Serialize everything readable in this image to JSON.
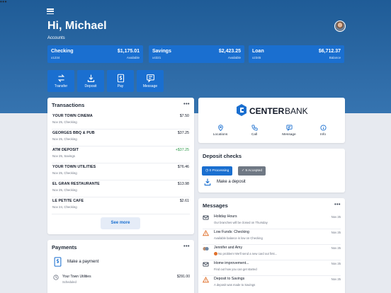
{
  "header": {
    "greeting": "Hi, Michael",
    "accounts_label": "Accounts",
    "more": "•••"
  },
  "accounts": [
    {
      "name": "Checking",
      "number": "x1234",
      "amount": "$1,175.01",
      "kind": "Available"
    },
    {
      "name": "Savings",
      "number": "x4321",
      "amount": "$2,423.25",
      "kind": "Available"
    },
    {
      "name": "Loan",
      "number": "x2345",
      "amount": "$6,712.37",
      "kind": "Balance"
    }
  ],
  "actions": [
    {
      "label": "Transfer",
      "icon": "transfer-icon"
    },
    {
      "label": "Deposit",
      "icon": "deposit-icon"
    },
    {
      "label": "Pay",
      "icon": "pay-icon"
    },
    {
      "label": "Message",
      "icon": "message-icon"
    }
  ],
  "transactions": {
    "title": "Transactions",
    "more": "•••",
    "items": [
      {
        "name": "YOUR TOWN CINEMA",
        "sub": "Nov 25, Checking",
        "amount": "$7.50",
        "positive": false
      },
      {
        "name": "GEORGES BBQ & PUB",
        "sub": "Nov 25, Checking",
        "amount": "$37.25",
        "positive": false
      },
      {
        "name": "ATM DEPOSIT",
        "sub": "Nov 25, Savings",
        "amount": "+$37.25",
        "positive": true
      },
      {
        "name": "YOUR TOWN UTILITIES",
        "sub": "Nov 25, Checking",
        "amount": "$76.46",
        "positive": false
      },
      {
        "name": "EL GRAN RESTAURANTE",
        "sub": "Nov 25, Checking",
        "amount": "$13.98",
        "positive": false
      },
      {
        "name": "LE PETITE CAFE",
        "sub": "Nov 24, Checking",
        "amount": "$2.61",
        "positive": false
      }
    ],
    "see_more": "See more"
  },
  "payments": {
    "title": "Payments",
    "more": "•••",
    "make_payment": "Make a payment",
    "items": [
      {
        "name": "Your Town Utilities",
        "status": "Scheduled",
        "amount": "$291.00"
      }
    ]
  },
  "bank": {
    "name_bold": "CENTER",
    "name_light": "BANK",
    "quick": [
      {
        "label": "Locations",
        "icon": "location-icon"
      },
      {
        "label": "Call",
        "icon": "phone-icon"
      },
      {
        "label": "Message",
        "icon": "message-icon"
      },
      {
        "label": "Info",
        "icon": "info-icon"
      }
    ]
  },
  "deposit_checks": {
    "title": "Deposit checks",
    "processing": "0 Processing",
    "accepted": "9 Accepted",
    "make_deposit": "Make a deposit"
  },
  "messages": {
    "title": "Messages",
    "more": "•••",
    "items": [
      {
        "title": "Holiday Hours",
        "preview": "Our branches will be closed on Thursday",
        "date": "Nov 25",
        "icon": "envelope-icon"
      },
      {
        "title": "Low Funds: Checking",
        "preview": "Available balance is low on Checking",
        "date": "Nov 25",
        "icon": "warning-icon"
      },
      {
        "title": "Jennifer and Amy",
        "preview": "No problem! We'll send a new card out first...",
        "date": "Nov 25",
        "icon": "avatar-group-icon"
      },
      {
        "title": "Home improvement...",
        "preview": "Find out how you can get started",
        "date": "Nov 25",
        "icon": "envelope-icon"
      },
      {
        "title": "Deposit to Savings",
        "preview": "A deposit was made to Savings",
        "date": "Nov 25",
        "icon": "warning-icon"
      }
    ]
  },
  "colors": {
    "primary": "#1a6fd0",
    "hero": "#2d6aa6",
    "positive": "#2e9a4a",
    "warning": "#e0702b"
  }
}
